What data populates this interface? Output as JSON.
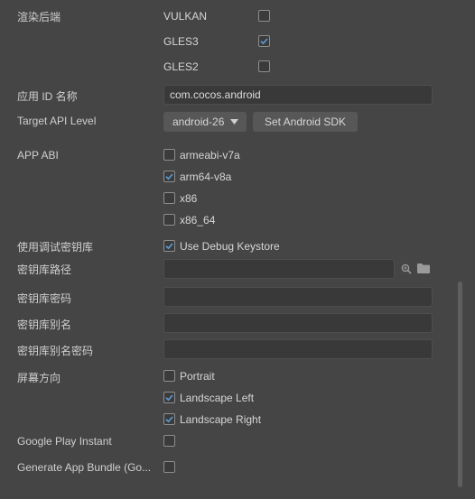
{
  "render_backend": {
    "label": "渲染后端",
    "options": [
      {
        "name": "VULKAN",
        "checked": false
      },
      {
        "name": "GLES3",
        "checked": true
      },
      {
        "name": "GLES2",
        "checked": false
      }
    ]
  },
  "package_name": {
    "label": "应用 ID 名称",
    "value": "com.cocos.android"
  },
  "target_api": {
    "label": "Target API Level",
    "selected": "android-26",
    "set_sdk_button": "Set Android SDK"
  },
  "app_abi": {
    "label": "APP ABI",
    "options": [
      {
        "name": "armeabi-v7a",
        "checked": false
      },
      {
        "name": "arm64-v8a",
        "checked": true
      },
      {
        "name": "x86",
        "checked": false
      },
      {
        "name": "x86_64",
        "checked": false
      }
    ]
  },
  "debug_keystore": {
    "label": "使用调试密钥库",
    "option": "Use Debug Keystore",
    "checked": true
  },
  "keystore_path": {
    "label": "密钥库路径",
    "value": ""
  },
  "keystore_password": {
    "label": "密钥库密码",
    "value": ""
  },
  "keystore_alias": {
    "label": "密钥库别名",
    "value": ""
  },
  "keystore_alias_password": {
    "label": "密钥库别名密码",
    "value": ""
  },
  "orientation": {
    "label": "屏幕方向",
    "options": [
      {
        "name": "Portrait",
        "checked": false
      },
      {
        "name": "Landscape Left",
        "checked": true
      },
      {
        "name": "Landscape Right",
        "checked": true
      }
    ]
  },
  "google_play_instant": {
    "label": "Google Play Instant",
    "checked": false
  },
  "app_bundle": {
    "label": "Generate App Bundle (Go...",
    "checked": false
  },
  "colors": {
    "background": "#454545",
    "input_bg": "#393939",
    "button_bg": "#575757",
    "text": "#cfcfcf",
    "check": "#5b9bd5"
  }
}
